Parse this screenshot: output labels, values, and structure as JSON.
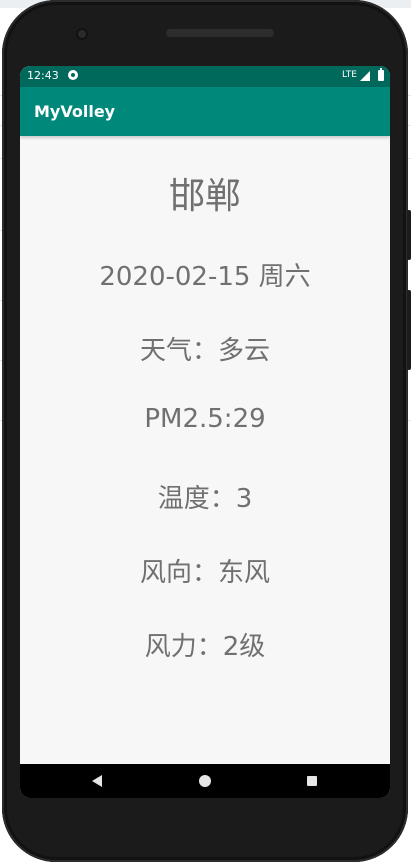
{
  "status_bar": {
    "time": "12:43",
    "network": "LTE",
    "sync_icon": "sync-icon",
    "signal_icon": "signal-icon",
    "battery_icon": "battery-icon"
  },
  "app_bar": {
    "title": "MyVolley",
    "color": "#00897b",
    "status_color": "#00695c"
  },
  "weather": {
    "city": "邯郸",
    "date": "2020-02-15 周六",
    "condition": "天气：多云",
    "pm25": "PM2.5:29",
    "temperature": "温度：3",
    "wind_direction": "风向：东风",
    "wind_force": "风力：2级"
  },
  "nav_bar": {
    "back_icon": "back-icon",
    "home_icon": "home-icon",
    "recents_icon": "recents-icon"
  },
  "colors": {
    "text": "#707070",
    "screen_background": "#f7f7f7"
  }
}
